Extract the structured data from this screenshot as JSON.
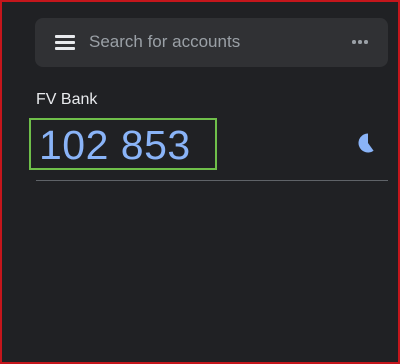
{
  "search": {
    "placeholder": "Search for accounts"
  },
  "accounts": [
    {
      "name": "FV Bank",
      "code": "102 853",
      "timer_remaining_fraction": 0.6
    }
  ],
  "colors": {
    "background": "#202124",
    "search_bar": "#303134",
    "code_text": "#8ab4f8",
    "timer": "#8ab4f8",
    "highlight_box": "#6fbf4a",
    "outer_border": "#c4161c"
  },
  "icons": {
    "menu": "menu-icon",
    "more": "more-options-icon",
    "timer": "countdown-timer-icon"
  }
}
